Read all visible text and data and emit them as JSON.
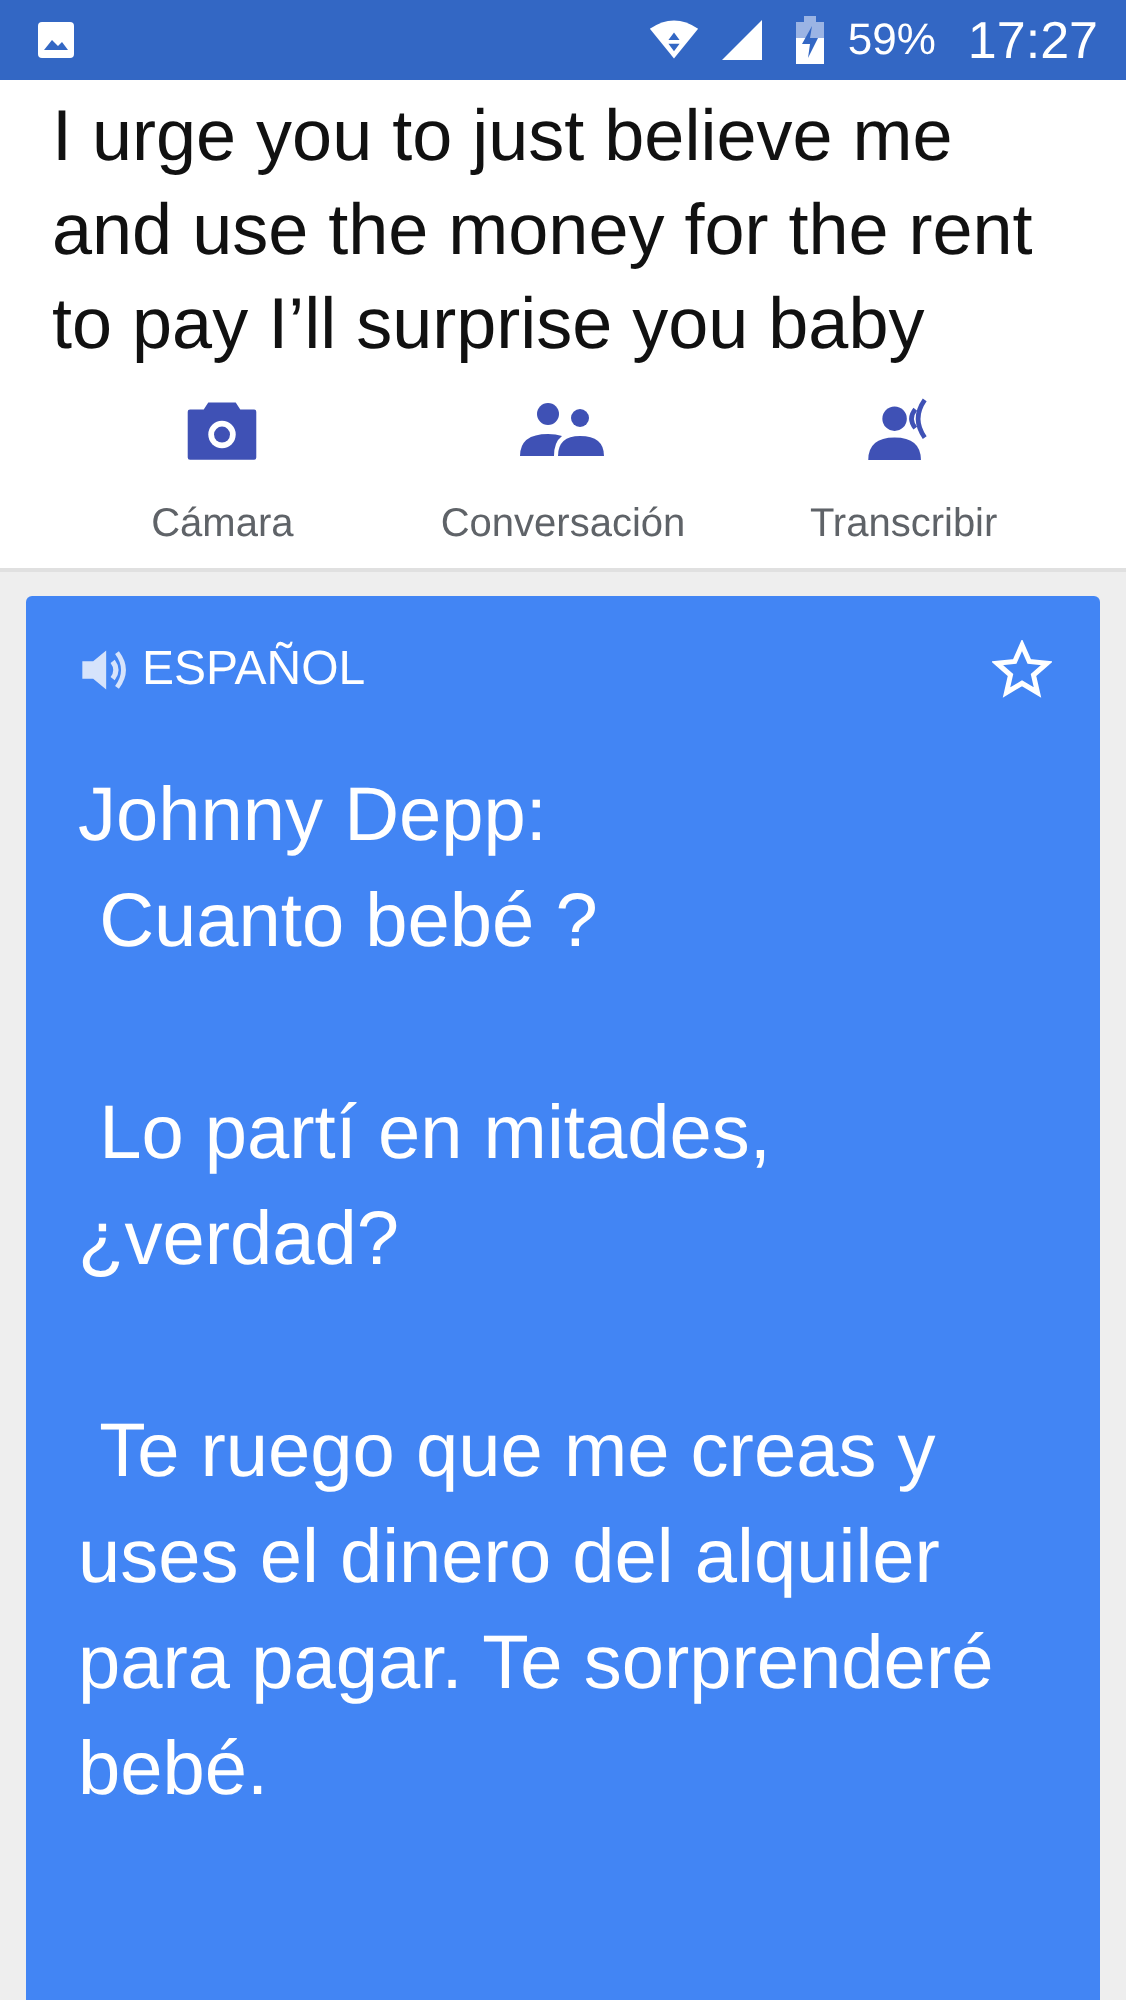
{
  "status_bar": {
    "battery": "59%",
    "time": "17:27"
  },
  "source_text": "I urge you to just believe me and use the money for the rent to pay I’ll surprise you baby",
  "actions": [
    {
      "kind": "camera",
      "label": "Cámara"
    },
    {
      "kind": "conversation",
      "label": "Conversación"
    },
    {
      "kind": "transcribe",
      "label": "Transcribir"
    }
  ],
  "translation": {
    "language": "ESPAÑOL",
    "starred": false,
    "text": "Johnny Depp:\n Cuanto bebé ?\n\n Lo partí en mitades, ¿verdad?\n\n Te ruego que me creas y uses el dinero del alquiler para pagar. Te sorprenderé bebé."
  }
}
